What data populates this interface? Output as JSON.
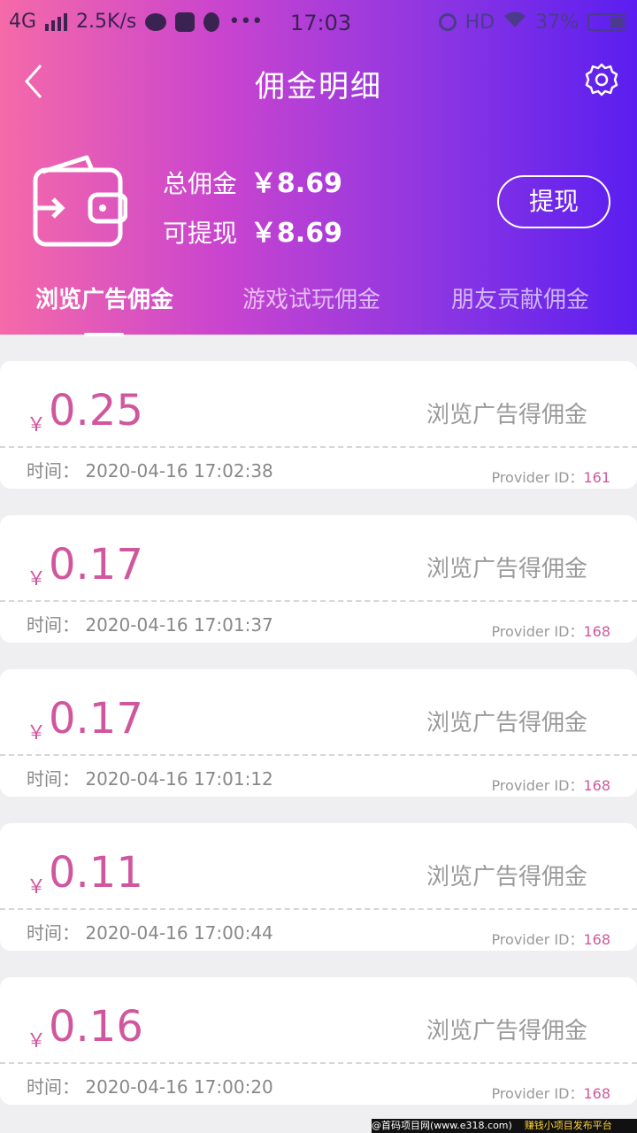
{
  "status_bar": {
    "network": "4G",
    "speed": "2.5K/s",
    "time": "17:03",
    "hd": "HD",
    "battery": "37%"
  },
  "nav": {
    "title": "佣金明细"
  },
  "summary": {
    "total_label": "总佣金",
    "total_amount": "￥8.69",
    "withdrawable_label": "可提现",
    "withdrawable_amount": "￥8.69",
    "withdraw_button": "提现"
  },
  "tabs": [
    {
      "label": "浏览广告佣金",
      "active": true
    },
    {
      "label": "游戏试玩佣金",
      "active": false
    },
    {
      "label": "朋友贡献佣金",
      "active": false
    }
  ],
  "records": [
    {
      "currency": "￥",
      "amount": "0.25",
      "type": "浏览广告得佣金",
      "time_label": "时间：",
      "time": "2020-04-16 17:02:38",
      "provider_label": "Provider ID：",
      "provider_id": "161"
    },
    {
      "currency": "￥",
      "amount": "0.17",
      "type": "浏览广告得佣金",
      "time_label": "时间：",
      "time": "2020-04-16 17:01:37",
      "provider_label": "Provider ID：",
      "provider_id": "168"
    },
    {
      "currency": "￥",
      "amount": "0.17",
      "type": "浏览广告得佣金",
      "time_label": "时间：",
      "time": "2020-04-16 17:01:12",
      "provider_label": "Provider ID：",
      "provider_id": "168"
    },
    {
      "currency": "￥",
      "amount": "0.11",
      "type": "浏览广告得佣金",
      "time_label": "时间：",
      "time": "2020-04-16 17:00:44",
      "provider_label": "Provider ID：",
      "provider_id": "168"
    },
    {
      "currency": "￥",
      "amount": "0.16",
      "type": "浏览广告得佣金",
      "time_label": "时间：",
      "time": "2020-04-16 17:00:20",
      "provider_label": "Provider ID：",
      "provider_id": "168"
    }
  ],
  "footer": {
    "site": "@首码项目网(www.e318.com)",
    "slogan": "赚钱小项目发布平台"
  },
  "colors": {
    "accent": "#d0579e",
    "gradient_start": "#f56aa8",
    "gradient_end": "#5a1ef0"
  }
}
